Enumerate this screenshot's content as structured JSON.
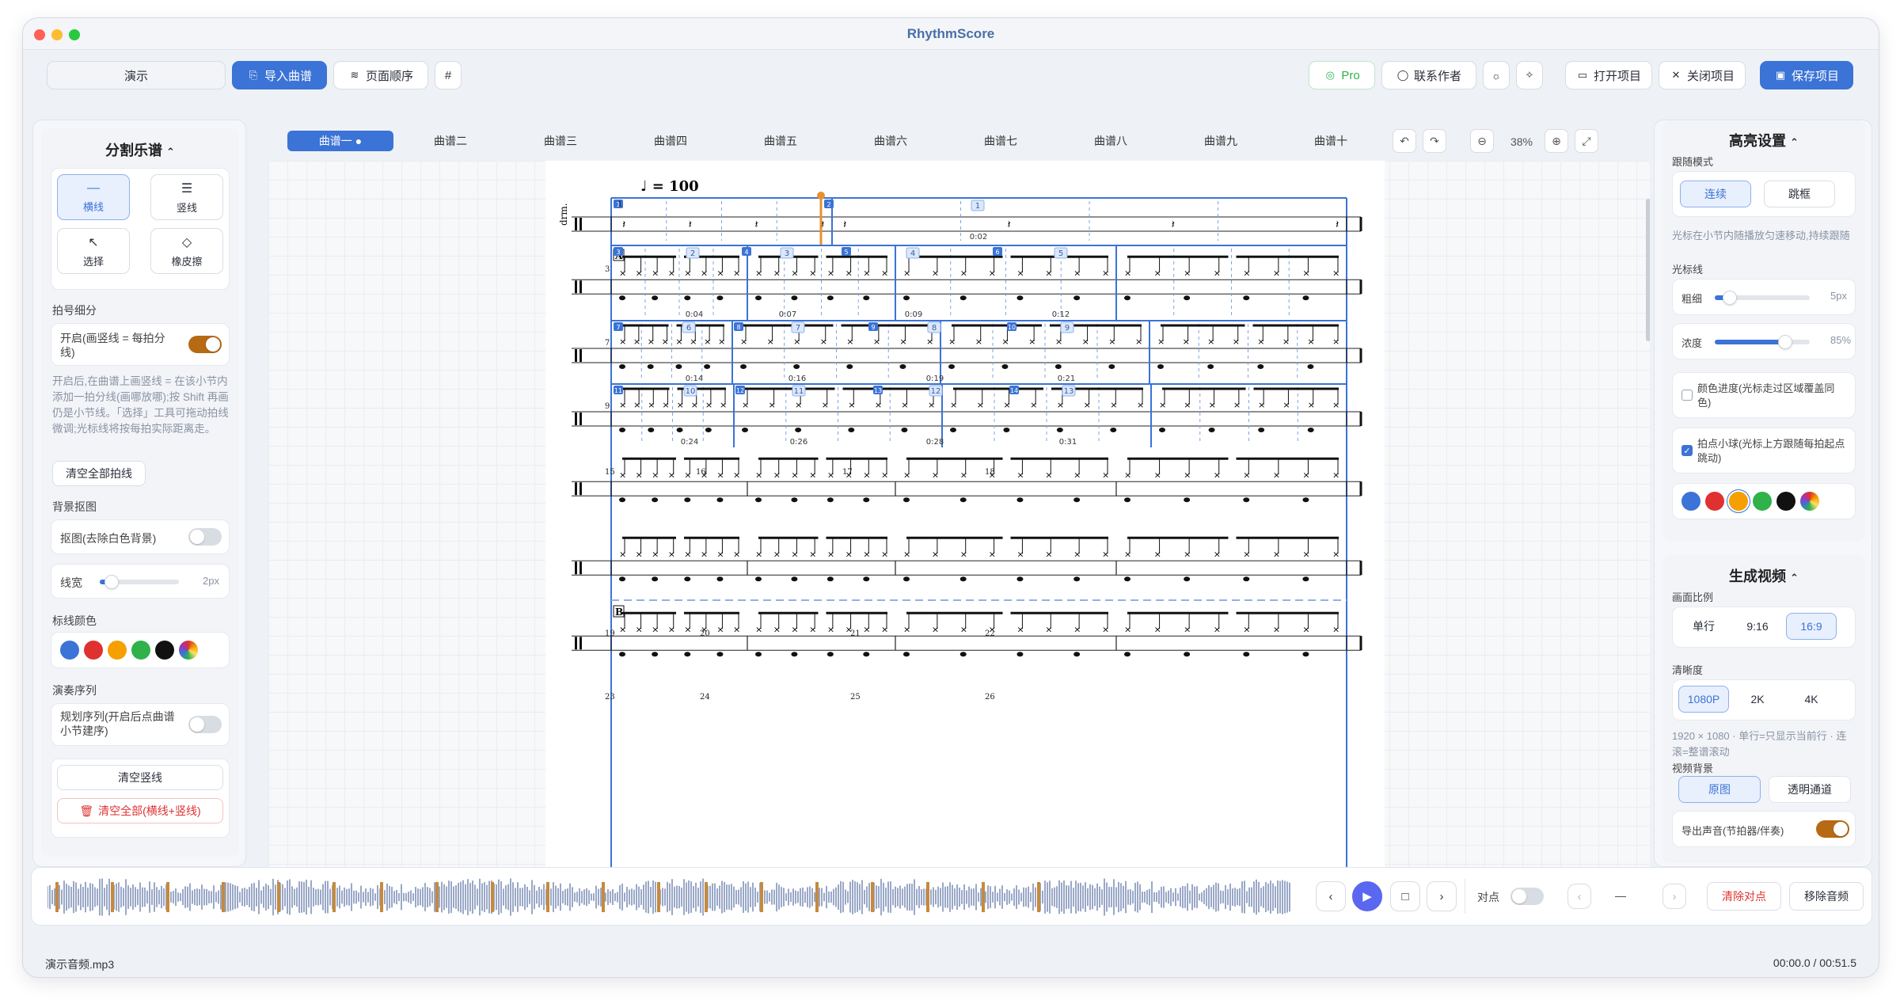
{
  "app": {
    "title": "RhythmScore"
  },
  "toolbar": {
    "demo": "演示",
    "import": "导入曲谱",
    "page_order": "页面顺序",
    "hash": "#",
    "pro": "Pro",
    "contact": "联系作者",
    "open_project": "打开项目",
    "close_project": "关闭项目",
    "save_project": "保存项目"
  },
  "left": {
    "split_title": "分割乐谱",
    "tools": [
      "横线",
      "竖线",
      "选择",
      "橡皮擦"
    ],
    "beat_title": "拍号细分",
    "beat_toggle_label": "开启(画竖线 = 每拍分线)",
    "beat_help": "开启后,在曲谱上画竖线 = 在该小节内添加一拍分线(画哪放哪);按 Shift 再画仍是小节线。「选择」工具可拖动拍线微调;光标线将按每拍实际距离走。",
    "clear_beats": "清空全部拍线",
    "bg_title": "背景抠图",
    "bg_toggle_label": "抠图(去除白色背景)",
    "line_width_label": "线宽",
    "line_width_value": "2px",
    "mark_color_title": "标线颜色",
    "play_seq_title": "演奏序列",
    "play_seq_label": "规划序列(开启后点曲谱小节建序)",
    "clear_vlines": "清空竖线",
    "clear_all": "清空全部(横线+竖线)"
  },
  "tabs": [
    "曲谱一 ●",
    "曲谱二",
    "曲谱三",
    "曲谱四",
    "曲谱五",
    "曲谱六",
    "曲谱七",
    "曲谱八",
    "曲谱九",
    "曲谱十"
  ],
  "zoom": "38%",
  "score": {
    "tempo": "♩ = 100",
    "instrument": "drm.",
    "section_a": "A",
    "section_b": "B",
    "timestamps": [
      "0:02",
      "0:04",
      "0:07",
      "0:09",
      "0:12",
      "0:14",
      "0:16",
      "0:19",
      "0:21",
      "0:24",
      "0:26",
      "0:28",
      "0:31"
    ],
    "measure_numbers": [
      "1",
      "3",
      "5",
      "7",
      "9",
      "10",
      "11",
      "13",
      "14",
      "15",
      "16",
      "17",
      "18",
      "19",
      "20",
      "21",
      "22",
      "23",
      "24",
      "25",
      "26"
    ]
  },
  "right": {
    "highlight_title": "高亮设置",
    "follow_mode_label": "跟随模式",
    "follow_continuous": "连续",
    "follow_jump": "跳框",
    "follow_help": "光标在小节内随播放匀速移动,持续跟随",
    "cursor_line_label": "光标线",
    "thickness_label": "粗细",
    "thickness_value": "5px",
    "opacity_label": "浓度",
    "opacity_value": "85%",
    "color_progress_label": "颜色进度(光标走过区域覆盖同色)",
    "beat_ball_label": "拍点小球(光标上方跟随每拍起点跳动)",
    "video_title": "生成视频",
    "ratio_label": "画面比例",
    "ratio_options": [
      "单行",
      "9:16",
      "16:9"
    ],
    "quality_label": "清晰度",
    "quality_options": [
      "1080P",
      "2K",
      "4K"
    ],
    "quality_help": "1920 × 1080 · 单行=只显示当前行 · 连滚=整谱滚动",
    "bg_label": "视频背景",
    "bg_options": [
      "原图",
      "透明通道"
    ],
    "export_audio_label": "导出声音(节拍器/伴奏)"
  },
  "bottom": {
    "align_label": "对点",
    "dash": "—",
    "clear_align": "清除对点",
    "remove_audio": "移除音频"
  },
  "status": {
    "file": "演示音频.mp3",
    "time": "00:00.0 / 00:51.5"
  },
  "colors": {
    "accent": "#3b73d6",
    "orange": "#b66a14",
    "swatches": [
      "#3b73d6",
      "#e03131",
      "#f59f00",
      "#2fb24a",
      "#111111",
      "rainbow"
    ]
  },
  "playback": {
    "progress": 0
  }
}
